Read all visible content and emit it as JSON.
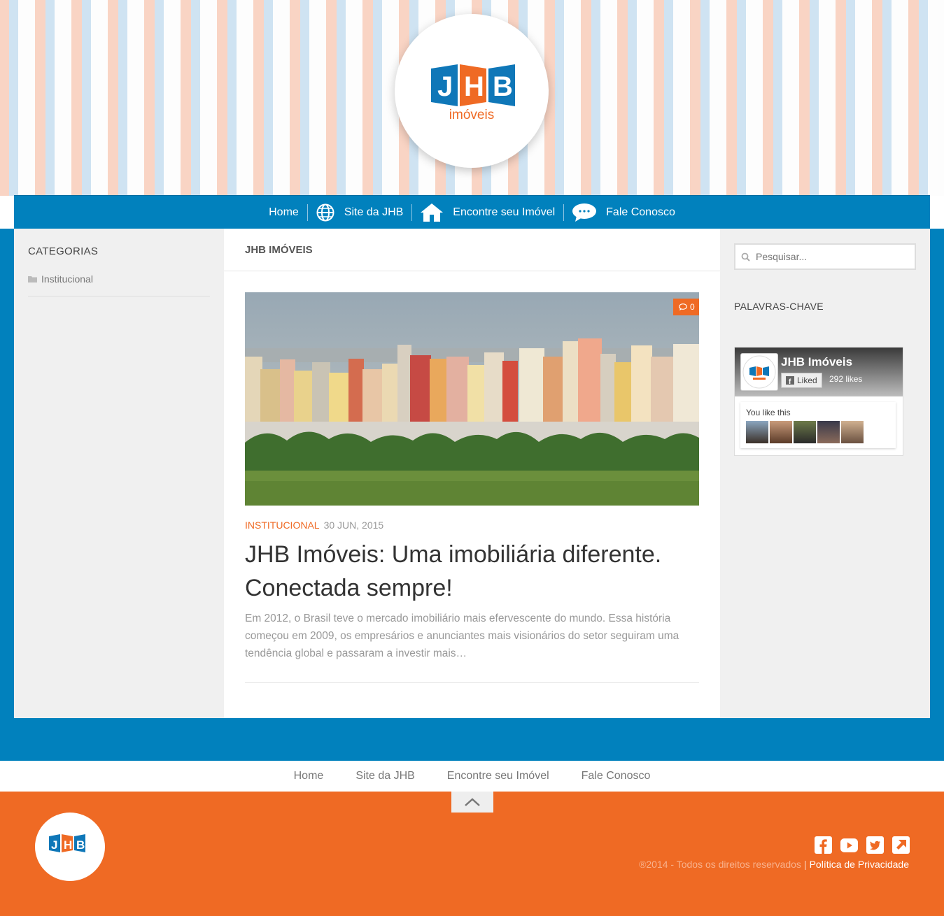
{
  "brand": {
    "logo_letters": "JHB",
    "logo_sub": "imóveis"
  },
  "nav": {
    "items": [
      {
        "label": "Home",
        "icon": "none"
      },
      {
        "label": "Site da JHB",
        "icon": "globe-icon"
      },
      {
        "label": "Encontre seu Imóvel",
        "icon": "house-icon"
      },
      {
        "label": "Fale Conosco",
        "icon": "speech-bubble-icon"
      }
    ]
  },
  "sidebar_left": {
    "title": "CATEGORIAS",
    "items": [
      "Institucional"
    ]
  },
  "main": {
    "heading": "JHB IMÓVEIS",
    "post": {
      "comments": "0",
      "category": "INSTITUCIONAL",
      "date": "30 JUN, 2015",
      "title": "JHB Imóveis: Uma imobiliária diferente. Conectada sempre!",
      "excerpt": "Em 2012, o Brasil teve o mercado imobiliário mais efervescente do mundo. Essa história começou em 2009, os empresários e anunciantes mais visionários do setor seguiram uma tendência global e passaram a investir mais…"
    }
  },
  "sidebar_right": {
    "search_placeholder": "Pesquisar...",
    "keywords_title": "PALAVRAS-CHAVE",
    "facebook": {
      "name": "JHB Imóveis",
      "liked": "Liked",
      "likes": "292 likes",
      "you_like": "You like this"
    }
  },
  "footer_nav": [
    "Home",
    "Site da JHB",
    "Encontre seu Imóvel",
    "Fale Conosco"
  ],
  "footer": {
    "copyright": "®2014 - Todos os direitos reservados",
    "separator": "|",
    "privacy": "Política de Privacidade",
    "social": [
      "facebook-icon",
      "youtube-icon",
      "twitter-icon",
      "external-link-icon"
    ]
  },
  "colors": {
    "blue": "#0181bd",
    "orange": "#ef6a24",
    "light_gray": "#f0f0f0"
  }
}
